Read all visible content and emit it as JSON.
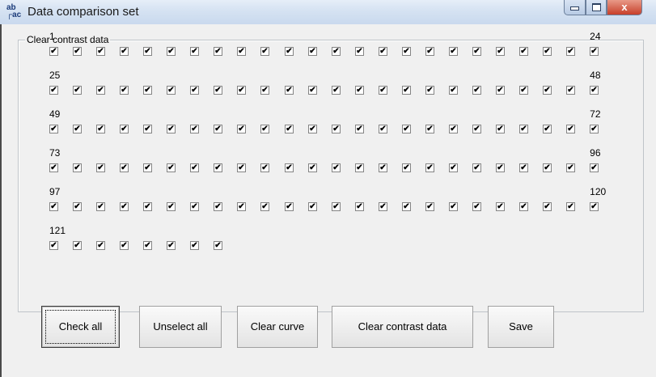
{
  "window": {
    "title": "Data comparison set",
    "icon": "ab-icon",
    "controls": {
      "minimize": "",
      "maximize": "",
      "close": "x"
    }
  },
  "group": {
    "label": "Clear contrast data",
    "rows": [
      {
        "start": "1",
        "end": "24",
        "count": 24
      },
      {
        "start": "25",
        "end": "48",
        "count": 24
      },
      {
        "start": "49",
        "end": "72",
        "count": 24
      },
      {
        "start": "73",
        "end": "96",
        "count": 24
      },
      {
        "start": "97",
        "end": "120",
        "count": 24
      },
      {
        "start": "121",
        "end": "",
        "count": 8
      }
    ],
    "checked": true,
    "check_glyph": "✔"
  },
  "buttons": {
    "check_all": "Check all",
    "unselect_all": "Unselect all",
    "clear_curve": "Clear curve",
    "clear_contrast_data": "Clear contrast data",
    "save": "Save"
  }
}
